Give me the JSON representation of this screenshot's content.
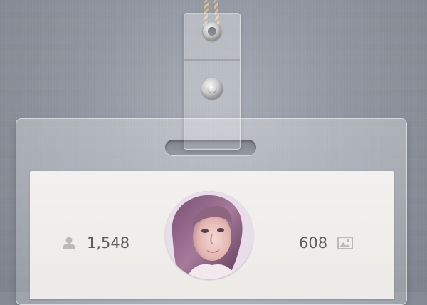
{
  "badge": {
    "followers_count": "1,548",
    "photos_count": "608"
  },
  "icons": {
    "left": "user-icon",
    "right": "image-icon"
  },
  "colors": {
    "background": "#9196a0",
    "card": "#f0efed",
    "text": "#5c5c5c",
    "icon": "#b9b9b9"
  }
}
